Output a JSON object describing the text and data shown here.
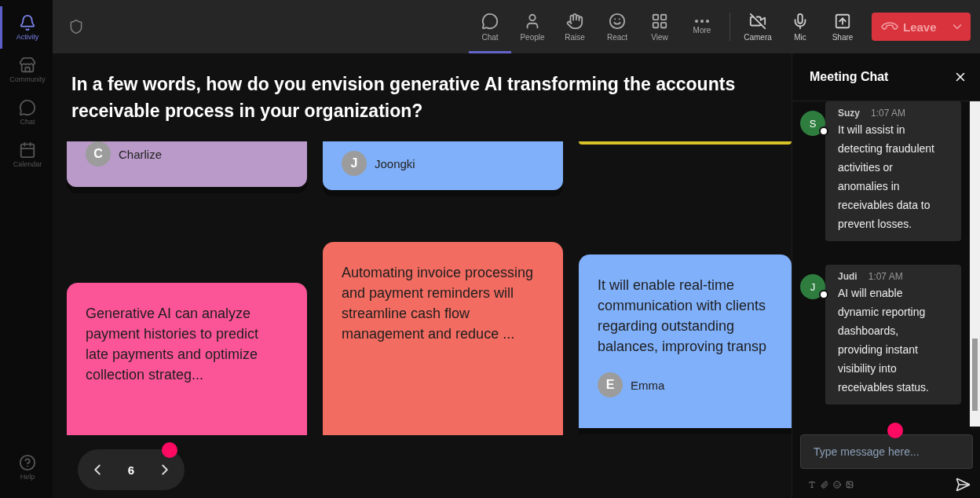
{
  "sidebar": {
    "items": [
      {
        "label": "Activity",
        "selected": true
      },
      {
        "label": "Community",
        "selected": false
      },
      {
        "label": "Chat",
        "selected": false
      },
      {
        "label": "Calendar",
        "selected": false
      }
    ],
    "help": "Help"
  },
  "toolbar": {
    "items": [
      {
        "label": "Chat",
        "selected": true
      },
      {
        "label": "People",
        "selected": false
      },
      {
        "label": "Raise",
        "selected": false
      },
      {
        "label": "React",
        "selected": false
      },
      {
        "label": "View",
        "selected": false
      },
      {
        "label": "More",
        "selected": false
      }
    ],
    "devices": [
      {
        "label": "Camera"
      },
      {
        "label": "Mic"
      },
      {
        "label": "Share"
      }
    ],
    "leave_button": "Leave"
  },
  "question": "In a few words, how do you envision generative AI transforming the accounts receivable process in your organization?",
  "columns": [
    {
      "cards": [
        {
          "kind": "cut",
          "color": "#b99ac8",
          "author": "Charlize",
          "initial": "C"
        },
        {
          "kind": "full",
          "color": "#fb5597",
          "text": "Generative AI can analyze payment histories to predict late payments and optimize collection strateg..."
        }
      ]
    },
    {
      "cards": [
        {
          "kind": "cut",
          "color": "#80b0fa",
          "author": "Joongki",
          "initial": "J"
        },
        {
          "kind": "full",
          "color": "#f26c61",
          "text": "Automating invoice processing and payment reminders will streamline cash flow management and reduce ..."
        }
      ]
    },
    {
      "cards": [
        {
          "kind": "edge",
          "color": "#d9c12a"
        },
        {
          "kind": "full",
          "color": "#80b0fa",
          "text": "It will enable real-time communication with clients regarding outstanding balances, improving transp",
          "author": "Emma",
          "initial": "E"
        }
      ]
    }
  ],
  "pagination": {
    "page": "6"
  },
  "chat": {
    "title": "Meeting Chat",
    "messages": [
      {
        "name": "Suzy",
        "initial": "S",
        "time": "1:07 AM",
        "text": "It will assist in detecting fraudulent activities or anomalies in receivables data to prevent losses."
      },
      {
        "name": "Judi",
        "initial": "J",
        "time": "1:07 AM",
        "text": "AI will enable dynamic reporting dashboards, providing instant visibility into receivables status."
      }
    ],
    "input": {
      "placeholder": "Type message here..."
    }
  }
}
